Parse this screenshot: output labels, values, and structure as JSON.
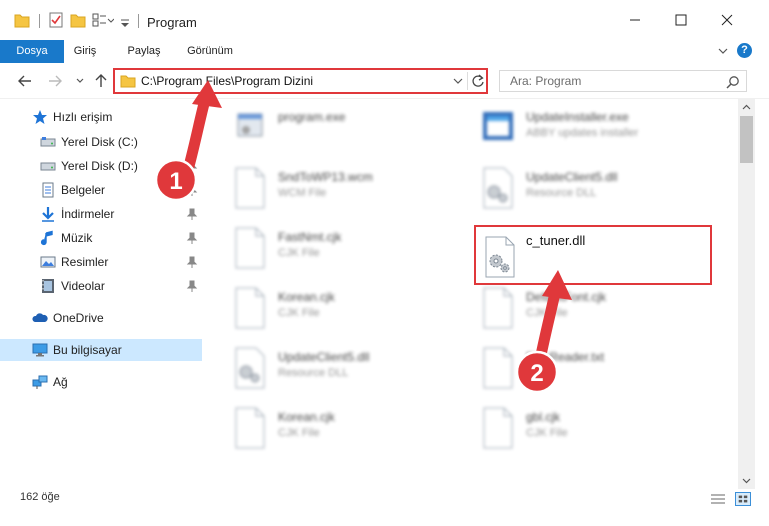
{
  "window": {
    "title": "Program"
  },
  "ribbon": {
    "tabs": [
      {
        "label": "Dosya",
        "active": true
      },
      {
        "label": "Giriş"
      },
      {
        "label": "Paylaş"
      },
      {
        "label": "Görünüm"
      }
    ],
    "help_label": "?"
  },
  "navigation": {
    "address": "C:\\Program Files\\Program Dizini",
    "search_placeholder": "Ara: Program"
  },
  "sidebar": {
    "items": [
      {
        "label": "Hızlı erişim",
        "icon": "star-icon"
      },
      {
        "label": "Yerel Disk (C:)",
        "icon": "drive-icon",
        "pinned": true
      },
      {
        "label": "Yerel Disk (D:)",
        "icon": "drive-icon",
        "pinned": true
      },
      {
        "label": "Belgeler",
        "icon": "documents-icon",
        "pinned": true
      },
      {
        "label": "İndirmeler",
        "icon": "download-icon",
        "pinned": true
      },
      {
        "label": "Müzik",
        "icon": "music-icon",
        "pinned": true
      },
      {
        "label": "Resimler",
        "icon": "pictures-icon",
        "pinned": true
      },
      {
        "label": "Videolar",
        "icon": "video-icon",
        "pinned": true
      },
      {
        "label": "OneDrive",
        "icon": "cloud-icon"
      },
      {
        "label": "Bu bilgisayar",
        "icon": "computer-icon",
        "selected": true
      },
      {
        "label": "Ağ",
        "icon": "network-icon"
      }
    ]
  },
  "files": [
    {
      "name": "program.exe",
      "type": "",
      "icon": "exe-icon"
    },
    {
      "name": "UpdateInstaller.exe",
      "type": "ABBY updates installer",
      "icon": "installer-icon"
    },
    {
      "name": "SndToWP13.wcm",
      "type": "WCM File",
      "icon": "blank-file-icon"
    },
    {
      "name": "UpdateClient5.dll",
      "type": "Resource DLL",
      "icon": "dll-icon"
    },
    {
      "name": "FastNmt.cjk",
      "type": "CJK File",
      "icon": "blank-file-icon"
    },
    {
      "name": "c_tuner.dll",
      "type": "",
      "icon": "dll-icon",
      "highlighted": true
    },
    {
      "name": "Korean.cjk",
      "type": "CJK File",
      "icon": "blank-file-icon"
    },
    {
      "name": "DefaultFont.cjk",
      "type": "CJK File",
      "icon": "blank-file-icon"
    },
    {
      "name": "UpdateClient5.dll",
      "type": "Resource DLL",
      "icon": "dll-icon"
    },
    {
      "name": "FineReader.txt",
      "type": "",
      "icon": "blank-file-icon"
    },
    {
      "name": "Korean.cjk",
      "type": "CJK File",
      "icon": "blank-file-icon"
    },
    {
      "name": "gbl.cjk",
      "type": "CJK File",
      "icon": "blank-file-icon"
    }
  ],
  "status": {
    "count": "162 öğe"
  },
  "annotations": [
    {
      "label": "1",
      "color": "#e0383b"
    },
    {
      "label": "2",
      "color": "#e0383b"
    }
  ]
}
